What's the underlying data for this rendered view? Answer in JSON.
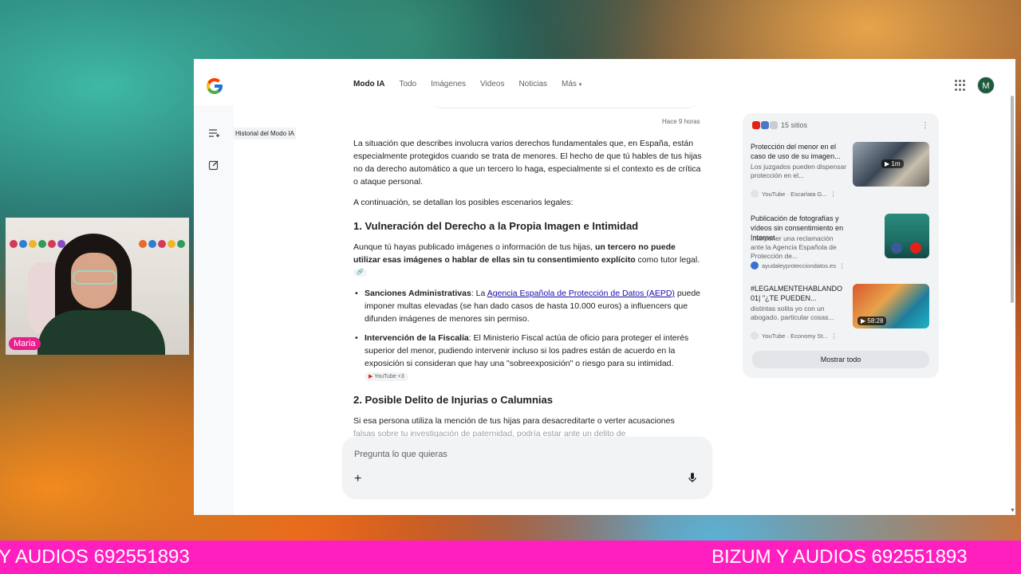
{
  "nav": {
    "tabs": [
      "Modo IA",
      "Todo",
      "Imágenes",
      "Videos",
      "Noticias",
      "Más"
    ],
    "active_tab": "Modo IA",
    "avatar_letter": "M"
  },
  "sidebar": {
    "tooltip": "Historial del Modo IA",
    "icons": [
      "history-icon",
      "new-chat-icon"
    ]
  },
  "conversation": {
    "timestamp": "Hace 9 horas",
    "intro": "La situación que describes involucra varios derechos fundamentales que, en España, están especialmente protegidos cuando se trata de menores. El hecho de que tú hables de tus hijas no da derecho automático a que un tercero lo haga, especialmente si el contexto es de crítica o ataque personal.",
    "lead": "A continuación, se detallan los posibles escenarios legales:",
    "section1": {
      "title": "1. Vulneración del Derecho a la Propia Imagen e Intimidad",
      "para_start": "Aunque tú hayas publicado imágenes o información de tus hijas, ",
      "para_bold": "un tercero no puede utilizar esas imágenes o hablar de ellas sin tu consentimiento explícito",
      "para_end": " como tutor legal.",
      "bullet1_bold": "Sanciones Administrativas",
      "bullet1_pre": ": La ",
      "bullet1_link": "Agencia Española de Protección de Datos (AEPD)",
      "bullet1_post": " puede imponer multas elevadas (se han dado casos de hasta 10.000 euros) a influencers que difunden imágenes de menores sin permiso.",
      "bullet2_bold": "Intervención de la Fiscalía",
      "bullet2_text": ": El Ministerio Fiscal actúa de oficio para proteger el interés superior del menor, pudiendo intervenir incluso si los padres están de acuerdo en la exposición si consideran que hay una \"sobreexposición\" o riesgo para su intimidad.",
      "bullet2_chip": "YouTube +3"
    },
    "section2": {
      "title": "2. Posible Delito de Injurias o Calumnias",
      "para": "Si esa persona utiliza la mención de tus hijas para desacreditarte o verter acusaciones",
      "para_cut": "falsas sobre tu investigación de paternidad, podría estar ante un delito de"
    }
  },
  "input": {
    "placeholder": "Pregunta lo que quieras"
  },
  "sources": {
    "count_label": "15 sitios",
    "cards": [
      {
        "title": "Protección del menor en el caso de uso de su imagen...",
        "snippet": "Los juzgados pueden dispensar protección en el...",
        "source": "YouTube · Escarlata G...",
        "badge": "1m"
      },
      {
        "title": "Publicación de fotografías y vídeos sin consentimiento en Internet",
        "snippet": "Interponer una reclamación ante la Agencia Española de Protección de...",
        "source": "ayudaleyprotecciondatos.es",
        "badge": ""
      },
      {
        "title": "#LEGALMENTEHABLANDO 01| \"¿TE PUEDEN...",
        "snippet": "distintas solita yo con un abogado. particular cosas...",
        "source": "YouTube · Economy St...",
        "badge": "58:28"
      }
    ],
    "show_all": "Mostrar todo"
  },
  "webcam": {
    "name": "Maria"
  },
  "ticker": {
    "left_text": "Y AUDIOS 692551893",
    "right_text": "BIZUM Y AUDIOS 692551893"
  },
  "colors": {
    "ticker_bg": "#ff1fbf",
    "link": "#1a0dab",
    "avatar_bg": "#1e5a3c",
    "name_tag": "#e91e8c"
  }
}
